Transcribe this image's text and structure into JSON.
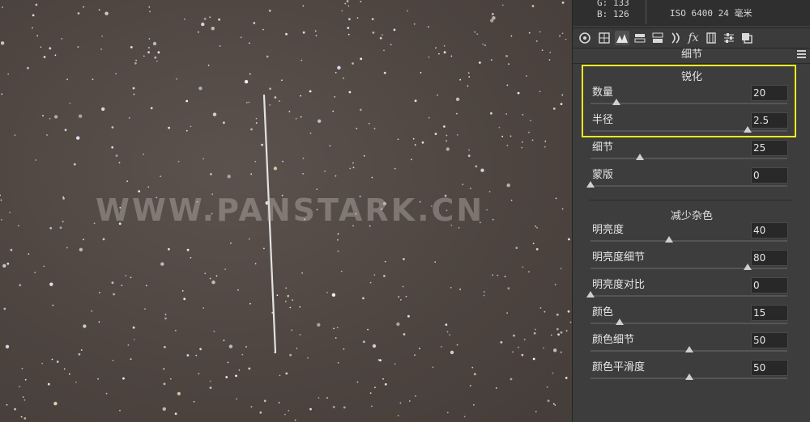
{
  "info": {
    "g": "G:   133",
    "b": "B:   126",
    "exif": "ISO 6400  24 毫米"
  },
  "watermark": "WWW.PANSTARK.CN",
  "panel": {
    "section_title": "细节",
    "tabs": [
      "basic-aperture-icon",
      "tone-curve-icon",
      "detail-icon",
      "hsl-icon",
      "split-toning-icon",
      "lens-icon",
      "fx-icon",
      "camera-calibration-icon",
      "sliders-icon",
      "presets-icon"
    ],
    "sharpen": {
      "title": "锐化",
      "sliders": [
        {
          "label": "数量",
          "value": "20",
          "pos": 0.13
        },
        {
          "label": "半径",
          "value": "2.5",
          "pos": 0.8
        },
        {
          "label": "细节",
          "value": "25",
          "pos": 0.25
        },
        {
          "label": "蒙版",
          "value": "0",
          "pos": 0.0
        }
      ]
    },
    "noise": {
      "title": "减少杂色",
      "sliders": [
        {
          "label": "明亮度",
          "value": "40",
          "pos": 0.4
        },
        {
          "label": "明亮度细节",
          "value": "80",
          "pos": 0.8
        },
        {
          "label": "明亮度对比",
          "value": "0",
          "pos": 0.0
        },
        {
          "label": "颜色",
          "value": "15",
          "pos": 0.15
        },
        {
          "label": "颜色细节",
          "value": "50",
          "pos": 0.5
        },
        {
          "label": "颜色平滑度",
          "value": "50",
          "pos": 0.5
        }
      ]
    }
  },
  "colors": {
    "highlight": "#f2ea1e",
    "panel_bg": "#3d3d3d"
  }
}
